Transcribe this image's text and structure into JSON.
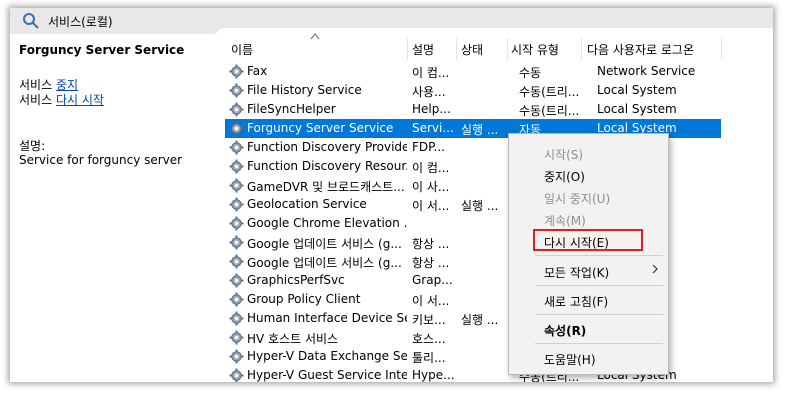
{
  "window": {
    "title": "서비스(로컬)",
    "title_icon": "search-gear-icon"
  },
  "left_pane": {
    "service_name": "Forguncy Server Service",
    "stop_prefix": "서비스 ",
    "stop_link": "중지",
    "restart_prefix": "서비스 ",
    "restart_link": "다시 시작",
    "description_label": "설명:",
    "description": "Service for forguncy server"
  },
  "columns": {
    "name": "이름",
    "description": "설명",
    "status": "상태",
    "startup": "시작 유형",
    "logon": "다음 사용자로 로그온"
  },
  "rows": [
    {
      "name": "Fax",
      "description": "이 컴...",
      "status": "",
      "startup": "수동",
      "logon": "Network Service"
    },
    {
      "name": "File History Service",
      "description": "사용...",
      "status": "",
      "startup": "수동(트리...",
      "logon": "Local System"
    },
    {
      "name": "FileSyncHelper",
      "description": "Help...",
      "status": "",
      "startup": "수동(트리...",
      "logon": "Local System"
    },
    {
      "name": "Forguncy Server Service",
      "description": "Servi...",
      "status": "실행 ...",
      "startup": "자동",
      "logon": "Local System"
    },
    {
      "name": "Function Discovery Provide...",
      "description": "FDP...",
      "status": "",
      "startup": "",
      "logon": ""
    },
    {
      "name": "Function Discovery Resour...",
      "description": "이 컴...",
      "status": "",
      "startup": "",
      "logon": ""
    },
    {
      "name": "GameDVR 및 브로드캐스트...",
      "description": "이 사...",
      "status": "",
      "startup": "",
      "logon": ""
    },
    {
      "name": "Geolocation Service",
      "description": "이 서...",
      "status": "실행 ...",
      "startup": "",
      "logon": ""
    },
    {
      "name": "Google Chrome Elevation ...",
      "description": "",
      "status": "",
      "startup": "",
      "logon": ""
    },
    {
      "name": "Google 업데이트 서비스 (g...",
      "description": "항상 ...",
      "status": "",
      "startup": "",
      "logon": ""
    },
    {
      "name": "Google 업데이트 서비스 (g...",
      "description": "항상 ...",
      "status": "",
      "startup": "",
      "logon": ""
    },
    {
      "name": "GraphicsPerfSvc",
      "description": "Grap...",
      "status": "",
      "startup": "",
      "logon": ""
    },
    {
      "name": "Group Policy Client",
      "description": "이 서...",
      "status": "",
      "startup": "",
      "logon": ""
    },
    {
      "name": "Human Interface Device Se...",
      "description": "키보...",
      "status": "실행 ...",
      "startup": "",
      "logon": ""
    },
    {
      "name": "HV 호스트 서비스",
      "description": "호스...",
      "status": "",
      "startup": "",
      "logon": ""
    },
    {
      "name": "Hyper-V Data Exchange Se...",
      "description": "툴리...",
      "status": "",
      "startup": "",
      "logon": ""
    },
    {
      "name": "Hyper-V Guest Service Inte...",
      "description": "Hype...",
      "status": "",
      "startup": "수동(트리...",
      "logon": "Local System"
    }
  ],
  "context_menu": {
    "start": "시작(S)",
    "stop": "중지(O)",
    "pause": "일시 중지(U)",
    "resume": "계속(M)",
    "restart": "다시 시작(E)",
    "all_tasks": "모든 작업(K)",
    "refresh": "새로 고침(F)",
    "properties": "속성(R)",
    "help": "도움말(H)"
  },
  "colors": {
    "selection": "#0078d7",
    "highlight_border": "#e02020",
    "link": "#0645ad"
  }
}
